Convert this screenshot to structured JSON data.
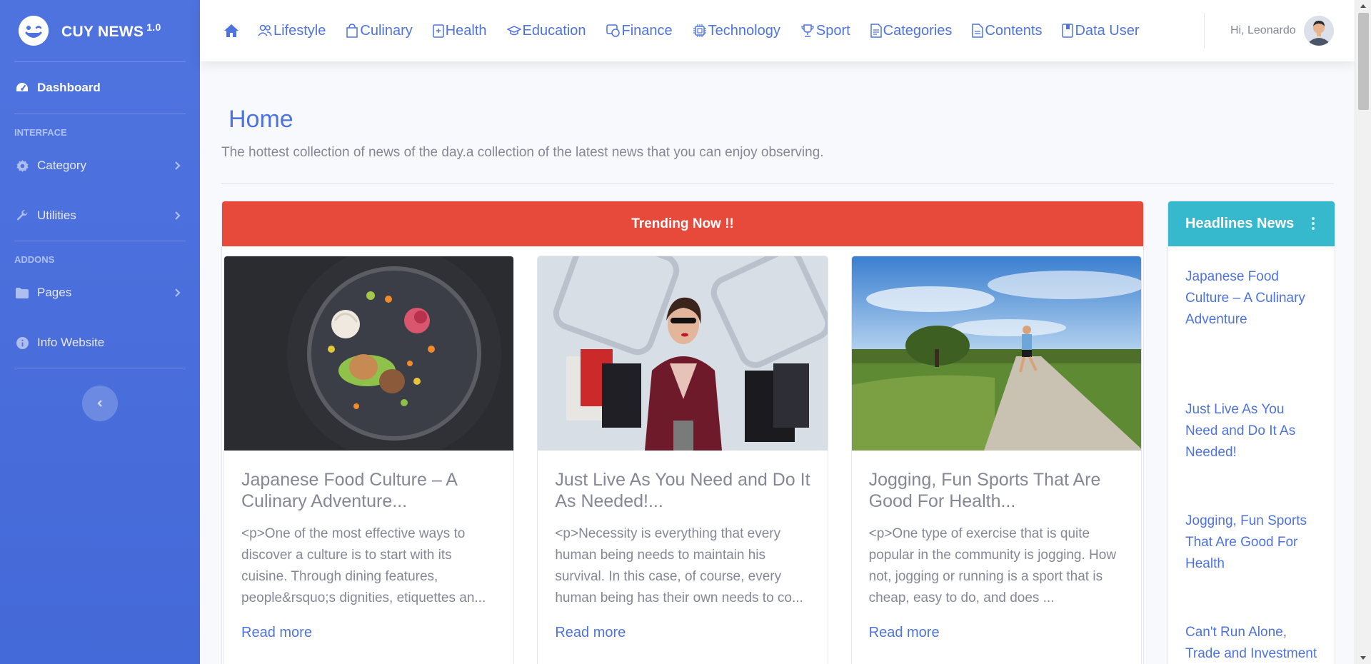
{
  "brand": {
    "name": "CUY NEWS",
    "version": "1.0"
  },
  "sidebar": {
    "dashboard": "Dashboard",
    "section_interface": "INTERFACE",
    "category": "Category",
    "utilities": "Utilities",
    "section_addons": "ADDONS",
    "pages": "Pages",
    "info": "Info Website"
  },
  "topnav": {
    "items": [
      "Lifestyle",
      "Culinary",
      "Health",
      "Education",
      "Finance",
      "Technology",
      "Sport",
      "Categories",
      "Contents",
      "Data User"
    ]
  },
  "user": {
    "greeting": "Hi, Leonardo"
  },
  "page": {
    "title": "Home",
    "subtitle": "The hottest collection of news of the day.a collection of the latest news that you can enjoy observing."
  },
  "trending": {
    "header": "Trending Now !!",
    "cards": [
      {
        "title": "Japanese Food Culture – A Culinary Adventure...",
        "text": "<p>One of the most effective ways to discover a culture is to start with its cuisine. Through dining features, people&rsquo;s dignities, etiquettes an...",
        "link": "Read more"
      },
      {
        "title": "Just Live As You Need and Do It As Needed!...",
        "text": "<p>Necessity is everything that every human being needs to maintain his survival. In this case, of course, every human being has their own needs to co...",
        "link": "Read more"
      },
      {
        "title": "Jogging, Fun Sports That Are Good For Health...",
        "text": "<p>One type of exercise that is quite popular in the community is jogging. How not, jogging or running is a sport that is cheap, easy to do, and does ...",
        "link": "Read more"
      }
    ]
  },
  "headlines": {
    "header": "Headlines News",
    "items": [
      "Japanese Food Culture – A Culinary Adventure",
      "Just Live As You Need and Do It As Needed!",
      "Jogging, Fun Sports That Are Good For Health",
      "Can't Run Alone, Trade and Investment Need to"
    ]
  },
  "colors": {
    "primary": "#4e73df",
    "danger": "#e74a3b",
    "info": "#36b9cc",
    "text_muted": "#858796"
  }
}
